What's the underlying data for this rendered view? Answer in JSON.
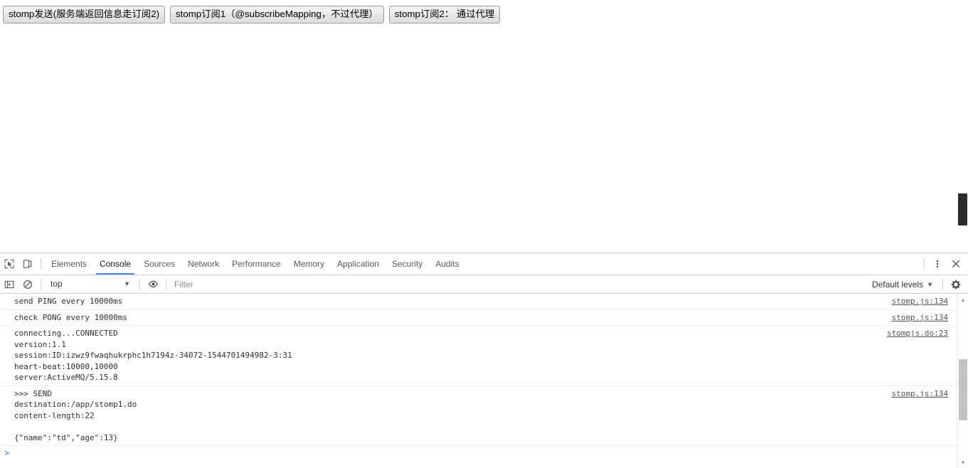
{
  "page": {
    "buttons": [
      {
        "label": "stomp发送(服务端返回信息走订阅2)",
        "name": "stomp-send-button"
      },
      {
        "label": "stomp订阅1（@subscribeMapping，不过代理）",
        "name": "stomp-subscribe1-button"
      },
      {
        "label": "stomp订阅2： 通过代理",
        "name": "stomp-subscribe2-button"
      }
    ]
  },
  "devtools": {
    "tabs": [
      {
        "label": "Elements",
        "active": false
      },
      {
        "label": "Console",
        "active": true
      },
      {
        "label": "Sources",
        "active": false
      },
      {
        "label": "Network",
        "active": false
      },
      {
        "label": "Performance",
        "active": false
      },
      {
        "label": "Memory",
        "active": false
      },
      {
        "label": "Application",
        "active": false
      },
      {
        "label": "Security",
        "active": false
      },
      {
        "label": "Audits",
        "active": false
      }
    ],
    "icons": {
      "inspect": "inspect-element-icon",
      "device": "device-toolbar-icon",
      "more": "more-options-icon",
      "close": "close-devtools-icon",
      "sidebar": "console-sidebar-icon",
      "clear": "clear-console-icon",
      "eye": "live-expression-icon",
      "settings": "settings-gear-icon"
    },
    "filterbar": {
      "context": "top",
      "context_caret": "▼",
      "filter_placeholder": "Filter",
      "filter_value": "",
      "levels": "Default levels",
      "levels_caret": "▼"
    },
    "accent_color": "#4285f4"
  },
  "console": {
    "messages": [
      {
        "text": "send PING every 10000ms",
        "source": "stomp.js:134"
      },
      {
        "text": "check PONG every 10000ms",
        "source": "stomp.js:134"
      },
      {
        "text": "connecting...CONNECTED\nversion:1.1\nsession:ID:izwz9fwaqhukrphc1h7194z-34072-1544701494982-3:31\nheart-beat:10000,10000\nserver:ActiveMQ/5.15.8",
        "source": "stompjs.do:23"
      },
      {
        "text": ">>> SEND\ndestination:/app/stomp1.do\ncontent-length:22\n\n{\"name\":\"td\",\"age\":13}",
        "source": "stomp.js:134"
      }
    ],
    "prompt": {
      "caret": ">",
      "value": ""
    }
  }
}
